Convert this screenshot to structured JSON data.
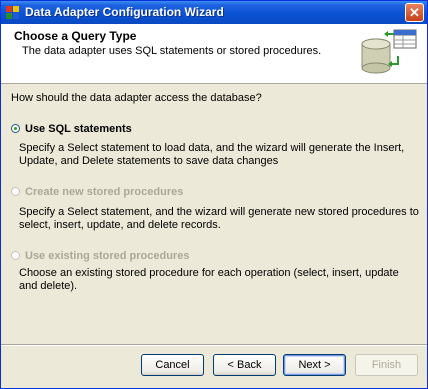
{
  "window": {
    "title": "Data Adapter Configuration Wizard",
    "close_symbol": "✕",
    "icons": [
      "app-icon",
      "close-icon"
    ]
  },
  "header": {
    "title": "Choose a Query Type",
    "subtitle": "The data adapter uses SQL statements or stored procedures.",
    "graphic_icon": "database-query-icon"
  },
  "main": {
    "question": "How should the data adapter access the database?",
    "options": [
      {
        "label": "Use SQL statements",
        "description": "Specify a Select statement to load data, and the wizard will generate the Insert, Update, and Delete statements to save data changes",
        "selected": true,
        "enabled": true
      },
      {
        "label": "Create new stored procedures",
        "description": "Specify a Select statement, and the wizard will generate new stored procedures to select, insert, update, and delete records.",
        "selected": false,
        "enabled": false
      },
      {
        "label": "Use existing stored procedures",
        "description": "Choose an existing stored procedure for each operation (select, insert, update and delete).",
        "selected": false,
        "enabled": false
      }
    ]
  },
  "buttons": {
    "cancel": "Cancel",
    "back": "< Back",
    "next": "Next >",
    "finish": "Finish"
  },
  "colors": {
    "titlebar": "#0A53D4",
    "window_bg": "#ECE9D8",
    "radio_selected": "#21A121",
    "disabled_text": "#ACA899"
  }
}
